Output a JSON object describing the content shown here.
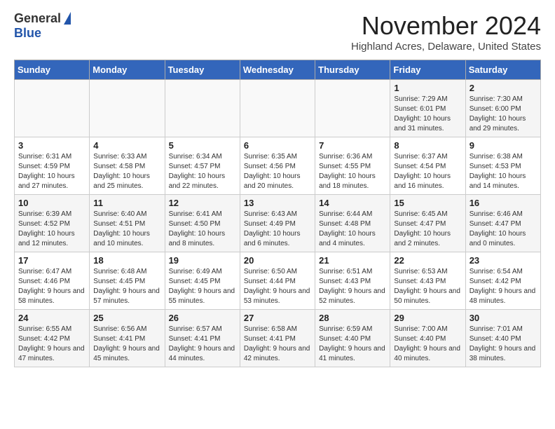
{
  "logo": {
    "general": "General",
    "blue": "Blue"
  },
  "title": "November 2024",
  "location": "Highland Acres, Delaware, United States",
  "days_of_week": [
    "Sunday",
    "Monday",
    "Tuesday",
    "Wednesday",
    "Thursday",
    "Friday",
    "Saturday"
  ],
  "weeks": [
    [
      {
        "day": "",
        "info": ""
      },
      {
        "day": "",
        "info": ""
      },
      {
        "day": "",
        "info": ""
      },
      {
        "day": "",
        "info": ""
      },
      {
        "day": "",
        "info": ""
      },
      {
        "day": "1",
        "info": "Sunrise: 7:29 AM\nSunset: 6:01 PM\nDaylight: 10 hours and 31 minutes."
      },
      {
        "day": "2",
        "info": "Sunrise: 7:30 AM\nSunset: 6:00 PM\nDaylight: 10 hours and 29 minutes."
      }
    ],
    [
      {
        "day": "3",
        "info": "Sunrise: 6:31 AM\nSunset: 4:59 PM\nDaylight: 10 hours and 27 minutes."
      },
      {
        "day": "4",
        "info": "Sunrise: 6:33 AM\nSunset: 4:58 PM\nDaylight: 10 hours and 25 minutes."
      },
      {
        "day": "5",
        "info": "Sunrise: 6:34 AM\nSunset: 4:57 PM\nDaylight: 10 hours and 22 minutes."
      },
      {
        "day": "6",
        "info": "Sunrise: 6:35 AM\nSunset: 4:56 PM\nDaylight: 10 hours and 20 minutes."
      },
      {
        "day": "7",
        "info": "Sunrise: 6:36 AM\nSunset: 4:55 PM\nDaylight: 10 hours and 18 minutes."
      },
      {
        "day": "8",
        "info": "Sunrise: 6:37 AM\nSunset: 4:54 PM\nDaylight: 10 hours and 16 minutes."
      },
      {
        "day": "9",
        "info": "Sunrise: 6:38 AM\nSunset: 4:53 PM\nDaylight: 10 hours and 14 minutes."
      }
    ],
    [
      {
        "day": "10",
        "info": "Sunrise: 6:39 AM\nSunset: 4:52 PM\nDaylight: 10 hours and 12 minutes."
      },
      {
        "day": "11",
        "info": "Sunrise: 6:40 AM\nSunset: 4:51 PM\nDaylight: 10 hours and 10 minutes."
      },
      {
        "day": "12",
        "info": "Sunrise: 6:41 AM\nSunset: 4:50 PM\nDaylight: 10 hours and 8 minutes."
      },
      {
        "day": "13",
        "info": "Sunrise: 6:43 AM\nSunset: 4:49 PM\nDaylight: 10 hours and 6 minutes."
      },
      {
        "day": "14",
        "info": "Sunrise: 6:44 AM\nSunset: 4:48 PM\nDaylight: 10 hours and 4 minutes."
      },
      {
        "day": "15",
        "info": "Sunrise: 6:45 AM\nSunset: 4:47 PM\nDaylight: 10 hours and 2 minutes."
      },
      {
        "day": "16",
        "info": "Sunrise: 6:46 AM\nSunset: 4:47 PM\nDaylight: 10 hours and 0 minutes."
      }
    ],
    [
      {
        "day": "17",
        "info": "Sunrise: 6:47 AM\nSunset: 4:46 PM\nDaylight: 9 hours and 58 minutes."
      },
      {
        "day": "18",
        "info": "Sunrise: 6:48 AM\nSunset: 4:45 PM\nDaylight: 9 hours and 57 minutes."
      },
      {
        "day": "19",
        "info": "Sunrise: 6:49 AM\nSunset: 4:45 PM\nDaylight: 9 hours and 55 minutes."
      },
      {
        "day": "20",
        "info": "Sunrise: 6:50 AM\nSunset: 4:44 PM\nDaylight: 9 hours and 53 minutes."
      },
      {
        "day": "21",
        "info": "Sunrise: 6:51 AM\nSunset: 4:43 PM\nDaylight: 9 hours and 52 minutes."
      },
      {
        "day": "22",
        "info": "Sunrise: 6:53 AM\nSunset: 4:43 PM\nDaylight: 9 hours and 50 minutes."
      },
      {
        "day": "23",
        "info": "Sunrise: 6:54 AM\nSunset: 4:42 PM\nDaylight: 9 hours and 48 minutes."
      }
    ],
    [
      {
        "day": "24",
        "info": "Sunrise: 6:55 AM\nSunset: 4:42 PM\nDaylight: 9 hours and 47 minutes."
      },
      {
        "day": "25",
        "info": "Sunrise: 6:56 AM\nSunset: 4:41 PM\nDaylight: 9 hours and 45 minutes."
      },
      {
        "day": "26",
        "info": "Sunrise: 6:57 AM\nSunset: 4:41 PM\nDaylight: 9 hours and 44 minutes."
      },
      {
        "day": "27",
        "info": "Sunrise: 6:58 AM\nSunset: 4:41 PM\nDaylight: 9 hours and 42 minutes."
      },
      {
        "day": "28",
        "info": "Sunrise: 6:59 AM\nSunset: 4:40 PM\nDaylight: 9 hours and 41 minutes."
      },
      {
        "day": "29",
        "info": "Sunrise: 7:00 AM\nSunset: 4:40 PM\nDaylight: 9 hours and 40 minutes."
      },
      {
        "day": "30",
        "info": "Sunrise: 7:01 AM\nSunset: 4:40 PM\nDaylight: 9 hours and 38 minutes."
      }
    ]
  ]
}
